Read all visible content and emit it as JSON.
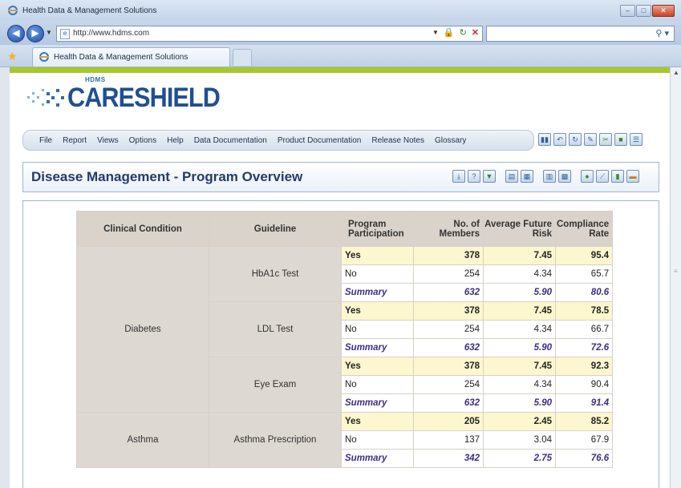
{
  "browser": {
    "window_title": "Health Data & Management Solutions",
    "url": "http://www.hdms.com",
    "tab_title": "Health Data & Management Solutions",
    "window_controls": [
      "minimize",
      "maximize",
      "close"
    ]
  },
  "logo": {
    "superscript": "HDMS",
    "name": "CARESHIELD",
    "brand_color": "#1f4f93",
    "accent_color": "#a8c82a"
  },
  "menu": {
    "items": [
      "File",
      "Report",
      "Views",
      "Options",
      "Help",
      "Data Documentation",
      "Product Documentation",
      "Release Notes",
      "Glossary"
    ]
  },
  "toolbar_top_icons": [
    "chart-icon",
    "undo-icon",
    "refresh-icon",
    "comment-icon",
    "tools-icon",
    "export-icon",
    "list-icon"
  ],
  "panel": {
    "title": "Disease Management - Program Overview",
    "toolbar_icons": [
      "drill-icon",
      "info-icon",
      "filter-icon",
      "table-icon",
      "crosstab-icon",
      "chart-bar-icon",
      "grid-icon",
      "globe-icon",
      "line-chart-icon",
      "column-chart-icon",
      "stacked-chart-icon"
    ]
  },
  "table": {
    "headers": {
      "condition": "Clinical Condition",
      "guideline": "Guideline",
      "participation": "Program Participation",
      "members": "No. of Members",
      "risk": "Average Future Risk",
      "compliance": "Compliance Rate"
    },
    "conditions": [
      {
        "name": "Diabetes",
        "guidelines": [
          {
            "name": "HbA1c Test",
            "rows": [
              {
                "type": "yes",
                "participation": "Yes",
                "members": "378",
                "risk": "7.45",
                "compliance": "95.4"
              },
              {
                "type": "no",
                "participation": "No",
                "members": "254",
                "risk": "4.34",
                "compliance": "65.7"
              },
              {
                "type": "sum",
                "participation": "Summary",
                "members": "632",
                "risk": "5.90",
                "compliance": "80.6"
              }
            ]
          },
          {
            "name": "LDL Test",
            "rows": [
              {
                "type": "yes",
                "participation": "Yes",
                "members": "378",
                "risk": "7.45",
                "compliance": "78.5"
              },
              {
                "type": "no",
                "participation": "No",
                "members": "254",
                "risk": "4.34",
                "compliance": "66.7"
              },
              {
                "type": "sum",
                "participation": "Summary",
                "members": "632",
                "risk": "5.90",
                "compliance": "72.6"
              }
            ]
          },
          {
            "name": "Eye Exam",
            "rows": [
              {
                "type": "yes",
                "participation": "Yes",
                "members": "378",
                "risk": "7.45",
                "compliance": "92.3"
              },
              {
                "type": "no",
                "participation": "No",
                "members": "254",
                "risk": "4.34",
                "compliance": "90.4"
              },
              {
                "type": "sum",
                "participation": "Summary",
                "members": "632",
                "risk": "5.90",
                "compliance": "91.4"
              }
            ]
          }
        ]
      },
      {
        "name": "Asthma",
        "guidelines": [
          {
            "name": "Asthma Prescription",
            "rows": [
              {
                "type": "yes",
                "participation": "Yes",
                "members": "205",
                "risk": "2.45",
                "compliance": "85.2"
              },
              {
                "type": "no",
                "participation": "No",
                "members": "137",
                "risk": "3.04",
                "compliance": "67.9"
              },
              {
                "type": "sum",
                "participation": "Summary",
                "members": "342",
                "risk": "2.75",
                "compliance": "76.6"
              }
            ]
          }
        ]
      }
    ]
  }
}
